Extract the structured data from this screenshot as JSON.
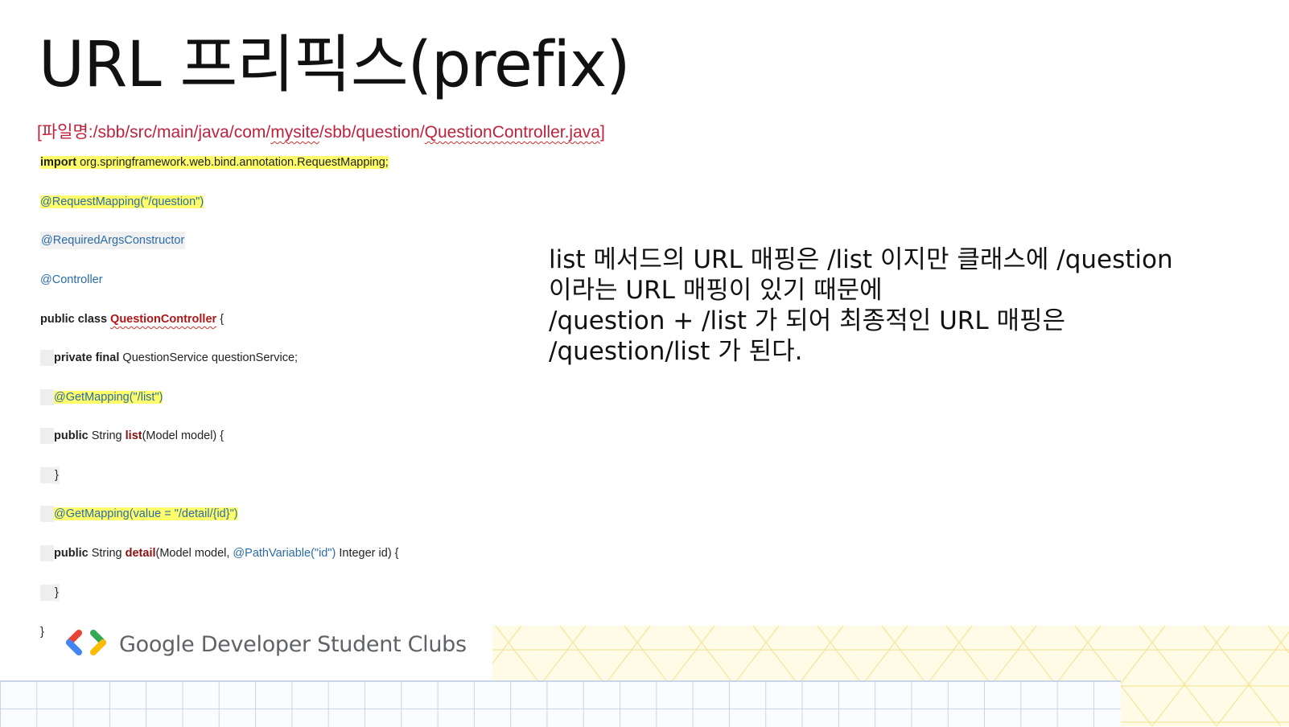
{
  "slide": {
    "title": "URL 프리픽스(prefix)",
    "file_path_prefix": "[파일명:/sbb/src/main/java/com/",
    "file_path_mysite": "mysite",
    "file_path_mid": "/sbb/question/",
    "file_path_file": "QuestionController.java",
    "file_path_suffix": "]"
  },
  "code": {
    "l1_kw": "import",
    "l1_rest": " org.springframework.web.bind.annotation.RequestMapping;",
    "l2": "@RequestMapping(\"/question\")",
    "l3": "@RequiredArgsConstructor",
    "l4": "@Controller",
    "l5_kw": "public class",
    "l5_cls": "QuestionController",
    "l5_rest": " {",
    "l6_kw": "private final",
    "l6_rest": " QuestionService questionService;",
    "l7": "@GetMapping(\"/list\")",
    "l8_kw": "public",
    "l8_mid": " String ",
    "l8_fn": "list",
    "l8_rest": "(Model model) {",
    "l9": "}",
    "l10": "@GetMapping(value = \"/detail/{id}\")",
    "l11_kw": "public",
    "l11_mid": " String ",
    "l11_fn": "detail",
    "l11_args": "(Model model, ",
    "l11_ann": "@PathVariable(\"id\")",
    "l11_rest": " Integer id) {",
    "l12": "}",
    "l13": "}"
  },
  "explanation": {
    "line1": "list 메서드의 URL 매핑은 /list 이지만 클래스에 /question",
    "line2": "이라는 URL 매핑이 있기 때문에",
    "line3": "/question + /list 가 되어 최종적인 URL 매핑은",
    "line4": "/question/list 가 된다."
  },
  "footer": {
    "brand": "Google Developer Student Clubs",
    "logo_icon": "gdsc-brackets-icon"
  },
  "colors": {
    "path": "#c0213a",
    "highlight": "#fffe6a",
    "annotation": "#2a6ca8",
    "class_name": "#b01616",
    "gdsc_red": "#ea4335",
    "gdsc_blue": "#4285f4",
    "gdsc_green": "#34a853",
    "gdsc_yellow": "#fbbc04"
  }
}
